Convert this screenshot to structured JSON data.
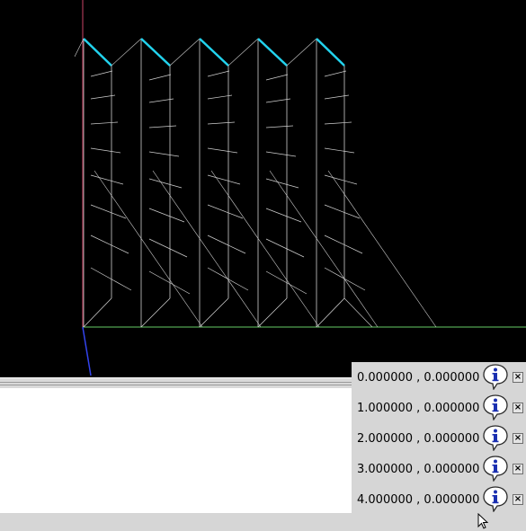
{
  "viewport": {
    "background": "#000000",
    "axis_colors": {
      "x": "#66cc66",
      "y": "#cc4466",
      "z": "#3344ee"
    },
    "highlight_color": "#22d3ee",
    "wire_color": "#cfcfcf"
  },
  "points_panel": {
    "rows": [
      {
        "coord": "0.000000 , 0.000000",
        "info_icon": "info-balloon-icon",
        "close_label": "×"
      },
      {
        "coord": "1.000000 , 0.000000",
        "info_icon": "info-balloon-icon",
        "close_label": "×"
      },
      {
        "coord": "2.000000 , 0.000000",
        "info_icon": "info-balloon-icon",
        "close_label": "×"
      },
      {
        "coord": "3.000000 , 0.000000",
        "info_icon": "info-balloon-icon",
        "close_label": "×"
      },
      {
        "coord": "4.000000 , 0.000000",
        "info_icon": "info-balloon-icon",
        "close_label": "×"
      }
    ]
  },
  "cursor": {
    "icon": "arrow-cursor-icon"
  }
}
